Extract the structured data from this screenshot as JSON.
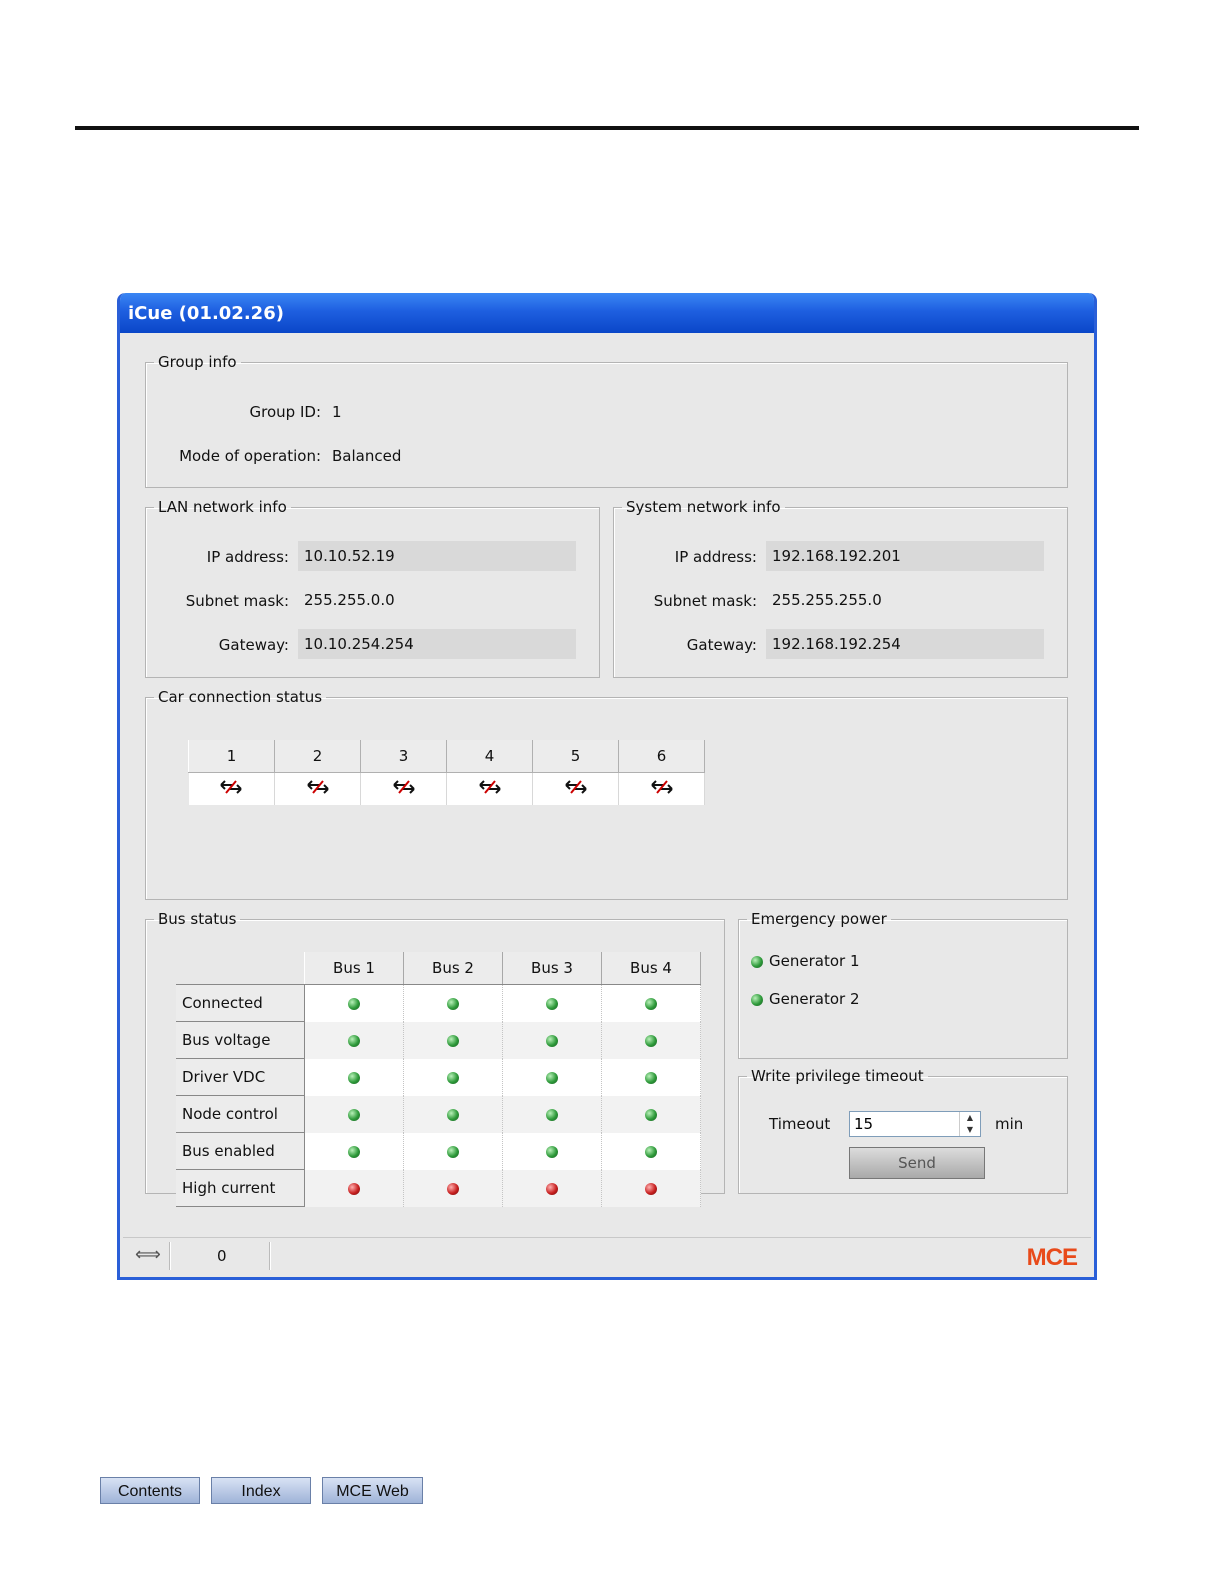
{
  "window": {
    "title": "iCue (01.02.26)"
  },
  "group_info": {
    "legend": "Group info",
    "group_id_label": "Group ID:",
    "group_id_value": "1",
    "mode_label": "Mode of operation:",
    "mode_value": "Balanced"
  },
  "lan": {
    "legend": "LAN network info",
    "ip_label": "IP address:",
    "ip_value": "10.10.52.19",
    "subnet_label": "Subnet mask:",
    "subnet_value": "255.255.0.0",
    "gateway_label": "Gateway:",
    "gateway_value": "10.10.254.254"
  },
  "system": {
    "legend": "System network info",
    "ip_label": "IP address:",
    "ip_value": "192.168.192.201",
    "subnet_label": "Subnet mask:",
    "subnet_value": "255.255.255.0",
    "gateway_label": "Gateway:",
    "gateway_value": "192.168.192.254"
  },
  "car": {
    "legend": "Car connection status",
    "cars": [
      "1",
      "2",
      "3",
      "4",
      "5",
      "6"
    ],
    "status_icon": "disconnected-arrows-icon"
  },
  "bus": {
    "legend": "Bus status",
    "columns": [
      "Bus 1",
      "Bus 2",
      "Bus 3",
      "Bus 4"
    ],
    "rows": [
      {
        "label": "Connected",
        "states": [
          "green",
          "green",
          "green",
          "green"
        ]
      },
      {
        "label": "Bus voltage",
        "states": [
          "green",
          "green",
          "green",
          "green"
        ]
      },
      {
        "label": "Driver VDC",
        "states": [
          "green",
          "green",
          "green",
          "green"
        ]
      },
      {
        "label": "Node control",
        "states": [
          "green",
          "green",
          "green",
          "green"
        ]
      },
      {
        "label": "Bus enabled",
        "states": [
          "green",
          "green",
          "green",
          "green"
        ]
      },
      {
        "label": "High current",
        "states": [
          "red",
          "red",
          "red",
          "red"
        ]
      }
    ]
  },
  "emergency": {
    "legend": "Emergency power",
    "generators": [
      {
        "label": "Generator 1",
        "state": "green"
      },
      {
        "label": "Generator 2",
        "state": "green"
      }
    ]
  },
  "write_privilege": {
    "legend": "Write privilege timeout",
    "timeout_label": "Timeout",
    "timeout_value": "15",
    "unit": "min",
    "send_label": "Send"
  },
  "statusbar": {
    "count": "0",
    "logo": "MCE"
  },
  "nav": {
    "contents": "Contents",
    "index": "Index",
    "mce_web": "MCE Web"
  },
  "colors": {
    "title_bar": "#1e5fe0",
    "ok": "#2e9a3a",
    "fault": "#c82020",
    "logo": "#e84a1a"
  }
}
